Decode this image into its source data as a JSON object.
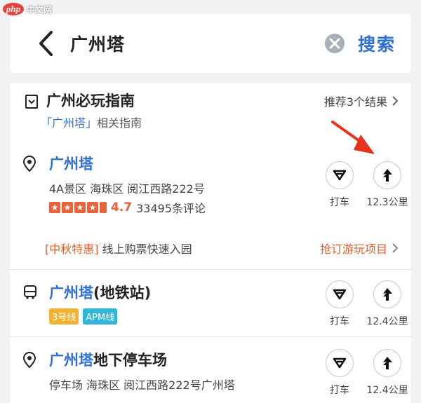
{
  "watermark": {
    "logo": "php",
    "text": "中文网"
  },
  "search": {
    "query": "广州塔",
    "button": "搜索"
  },
  "guide": {
    "title": "广州必玩指南",
    "sub_highlight": "「广州塔」",
    "sub_rest": "相关指南",
    "link": "推荐3个结果"
  },
  "results": [
    {
      "name_hl": "广州塔",
      "name_rest": "",
      "address": "4A景区 海珠区 阅江西路222号",
      "rating_score": "4.7",
      "review_count": "33495条评论",
      "taxi_label": "打车",
      "distance": "12.3公里"
    },
    {
      "name_hl": "广州塔",
      "name_rest": "(地铁站)",
      "tags": [
        {
          "text": "3号线",
          "color": "#f2b230"
        },
        {
          "text": "APM线",
          "color": "#2fb6d8"
        }
      ],
      "taxi_label": "打车",
      "distance": "12.4公里"
    },
    {
      "name_hl": "广州塔",
      "name_rest": "地下停车场",
      "address": "停车场 海珠区 阅江西路222号广州塔",
      "taxi_label": "打车",
      "distance": "12.4公里"
    }
  ],
  "promo": {
    "tag": "[中秋特惠]",
    "text": "线上购票快速入园",
    "link": "抢订游玩项目"
  },
  "colors": {
    "accent": "#2f6fd6",
    "orange": "#e0612c",
    "annotation": "#e8321e"
  }
}
